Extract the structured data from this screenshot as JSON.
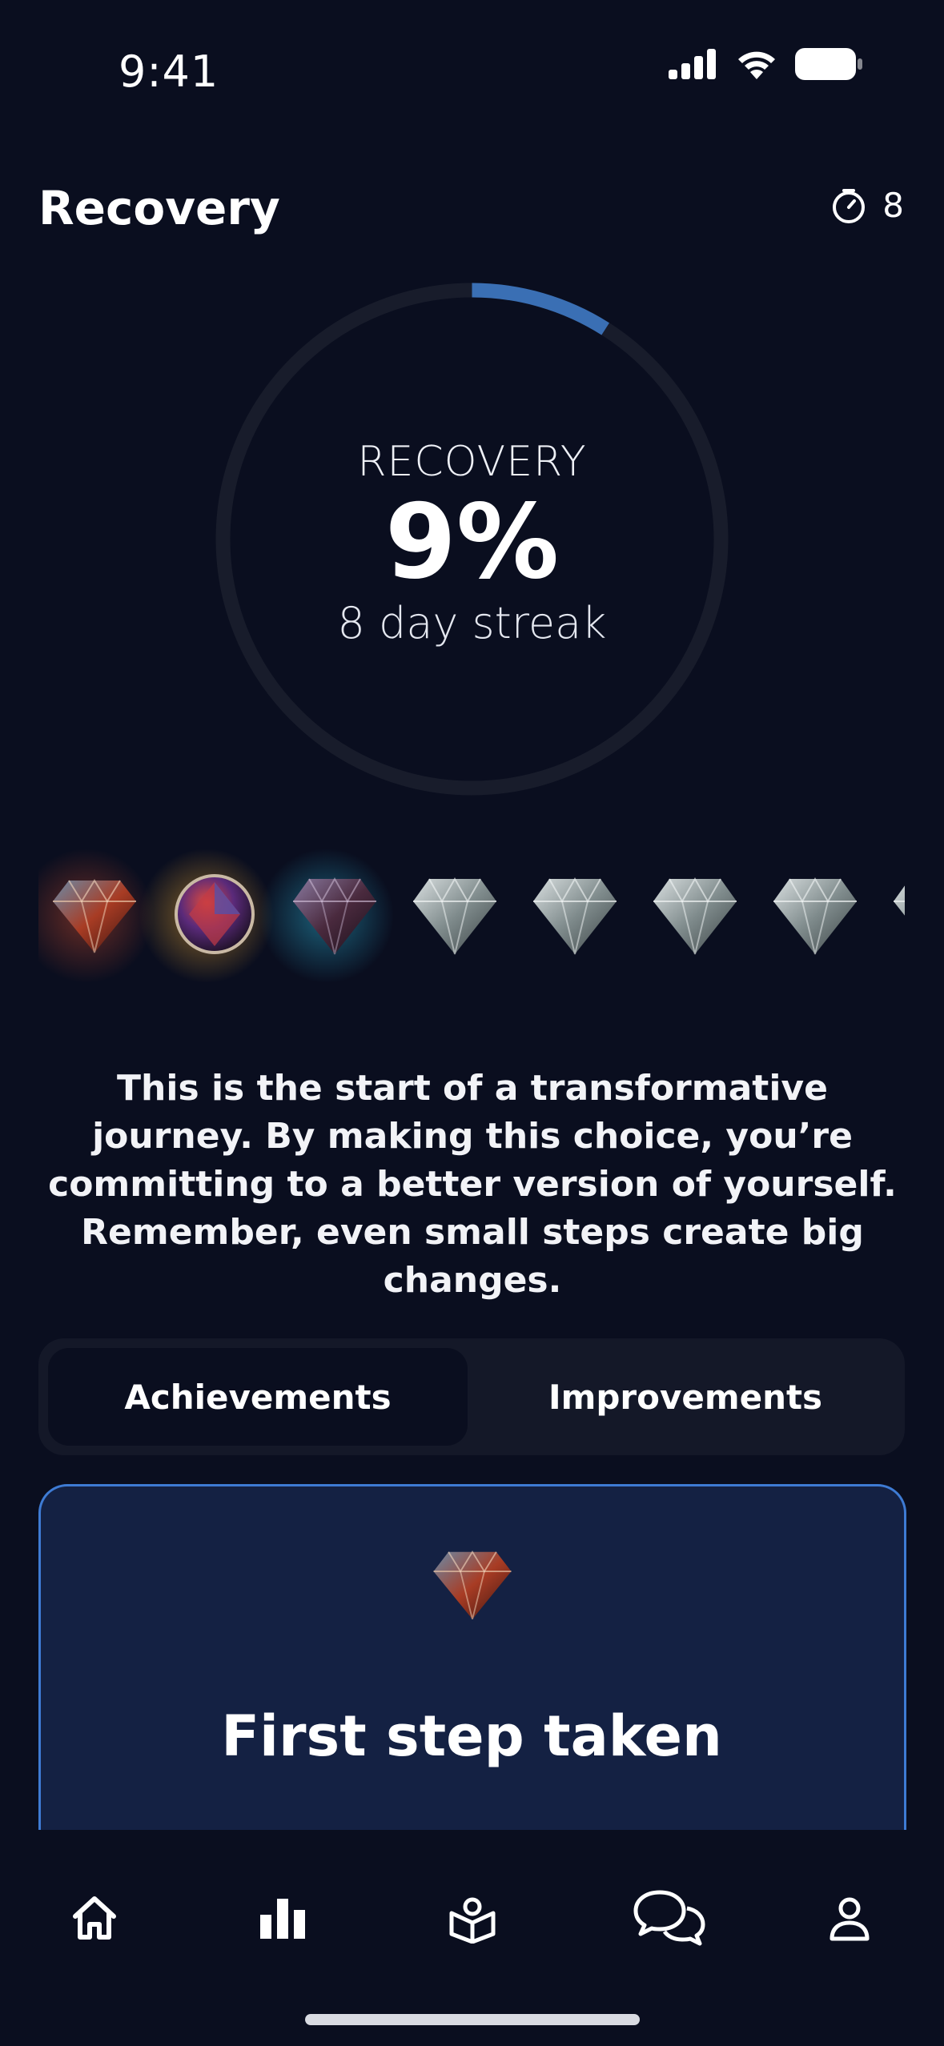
{
  "status_bar": {
    "time": "9:41",
    "icons": [
      "cellular-signal-icon",
      "wifi-icon",
      "battery-icon"
    ]
  },
  "header": {
    "title": "Recovery",
    "streak_icon": "timer-icon",
    "streak_count": "8"
  },
  "progress_ring": {
    "label": "RECOVERY",
    "value_text": "9%",
    "progress_fraction": 0.09,
    "subtitle": "8 day streak",
    "track_color": "#181c2b",
    "fill_color": "#3a6fb4"
  },
  "gems": [
    {
      "name": "red-gem-icon",
      "state": "earned"
    },
    {
      "name": "orb-gem-icon",
      "state": "earned"
    },
    {
      "name": "dark-gem-icon",
      "state": "earned"
    },
    {
      "name": "silver-gem-icon",
      "state": "locked"
    },
    {
      "name": "silver-gem-icon",
      "state": "locked"
    },
    {
      "name": "silver-gem-icon",
      "state": "locked"
    },
    {
      "name": "silver-gem-icon",
      "state": "locked"
    },
    {
      "name": "silver-gem-icon",
      "state": "locked"
    }
  ],
  "message": "This is the start of a transformative journey. By making this choice, you’re committing to a better version of yourself. Remember, even small steps create big changes.",
  "segmented": {
    "tabs": [
      "Achievements",
      "Improvements"
    ],
    "selected": "Achievements"
  },
  "achievement_card": {
    "icon": "red-gem-icon",
    "title": "First step taken",
    "border_color": "#3e7bd4"
  },
  "tab_bar": {
    "items": [
      "home-icon",
      "stats-icon",
      "learn-icon",
      "chat-icon",
      "profile-icon"
    ]
  }
}
